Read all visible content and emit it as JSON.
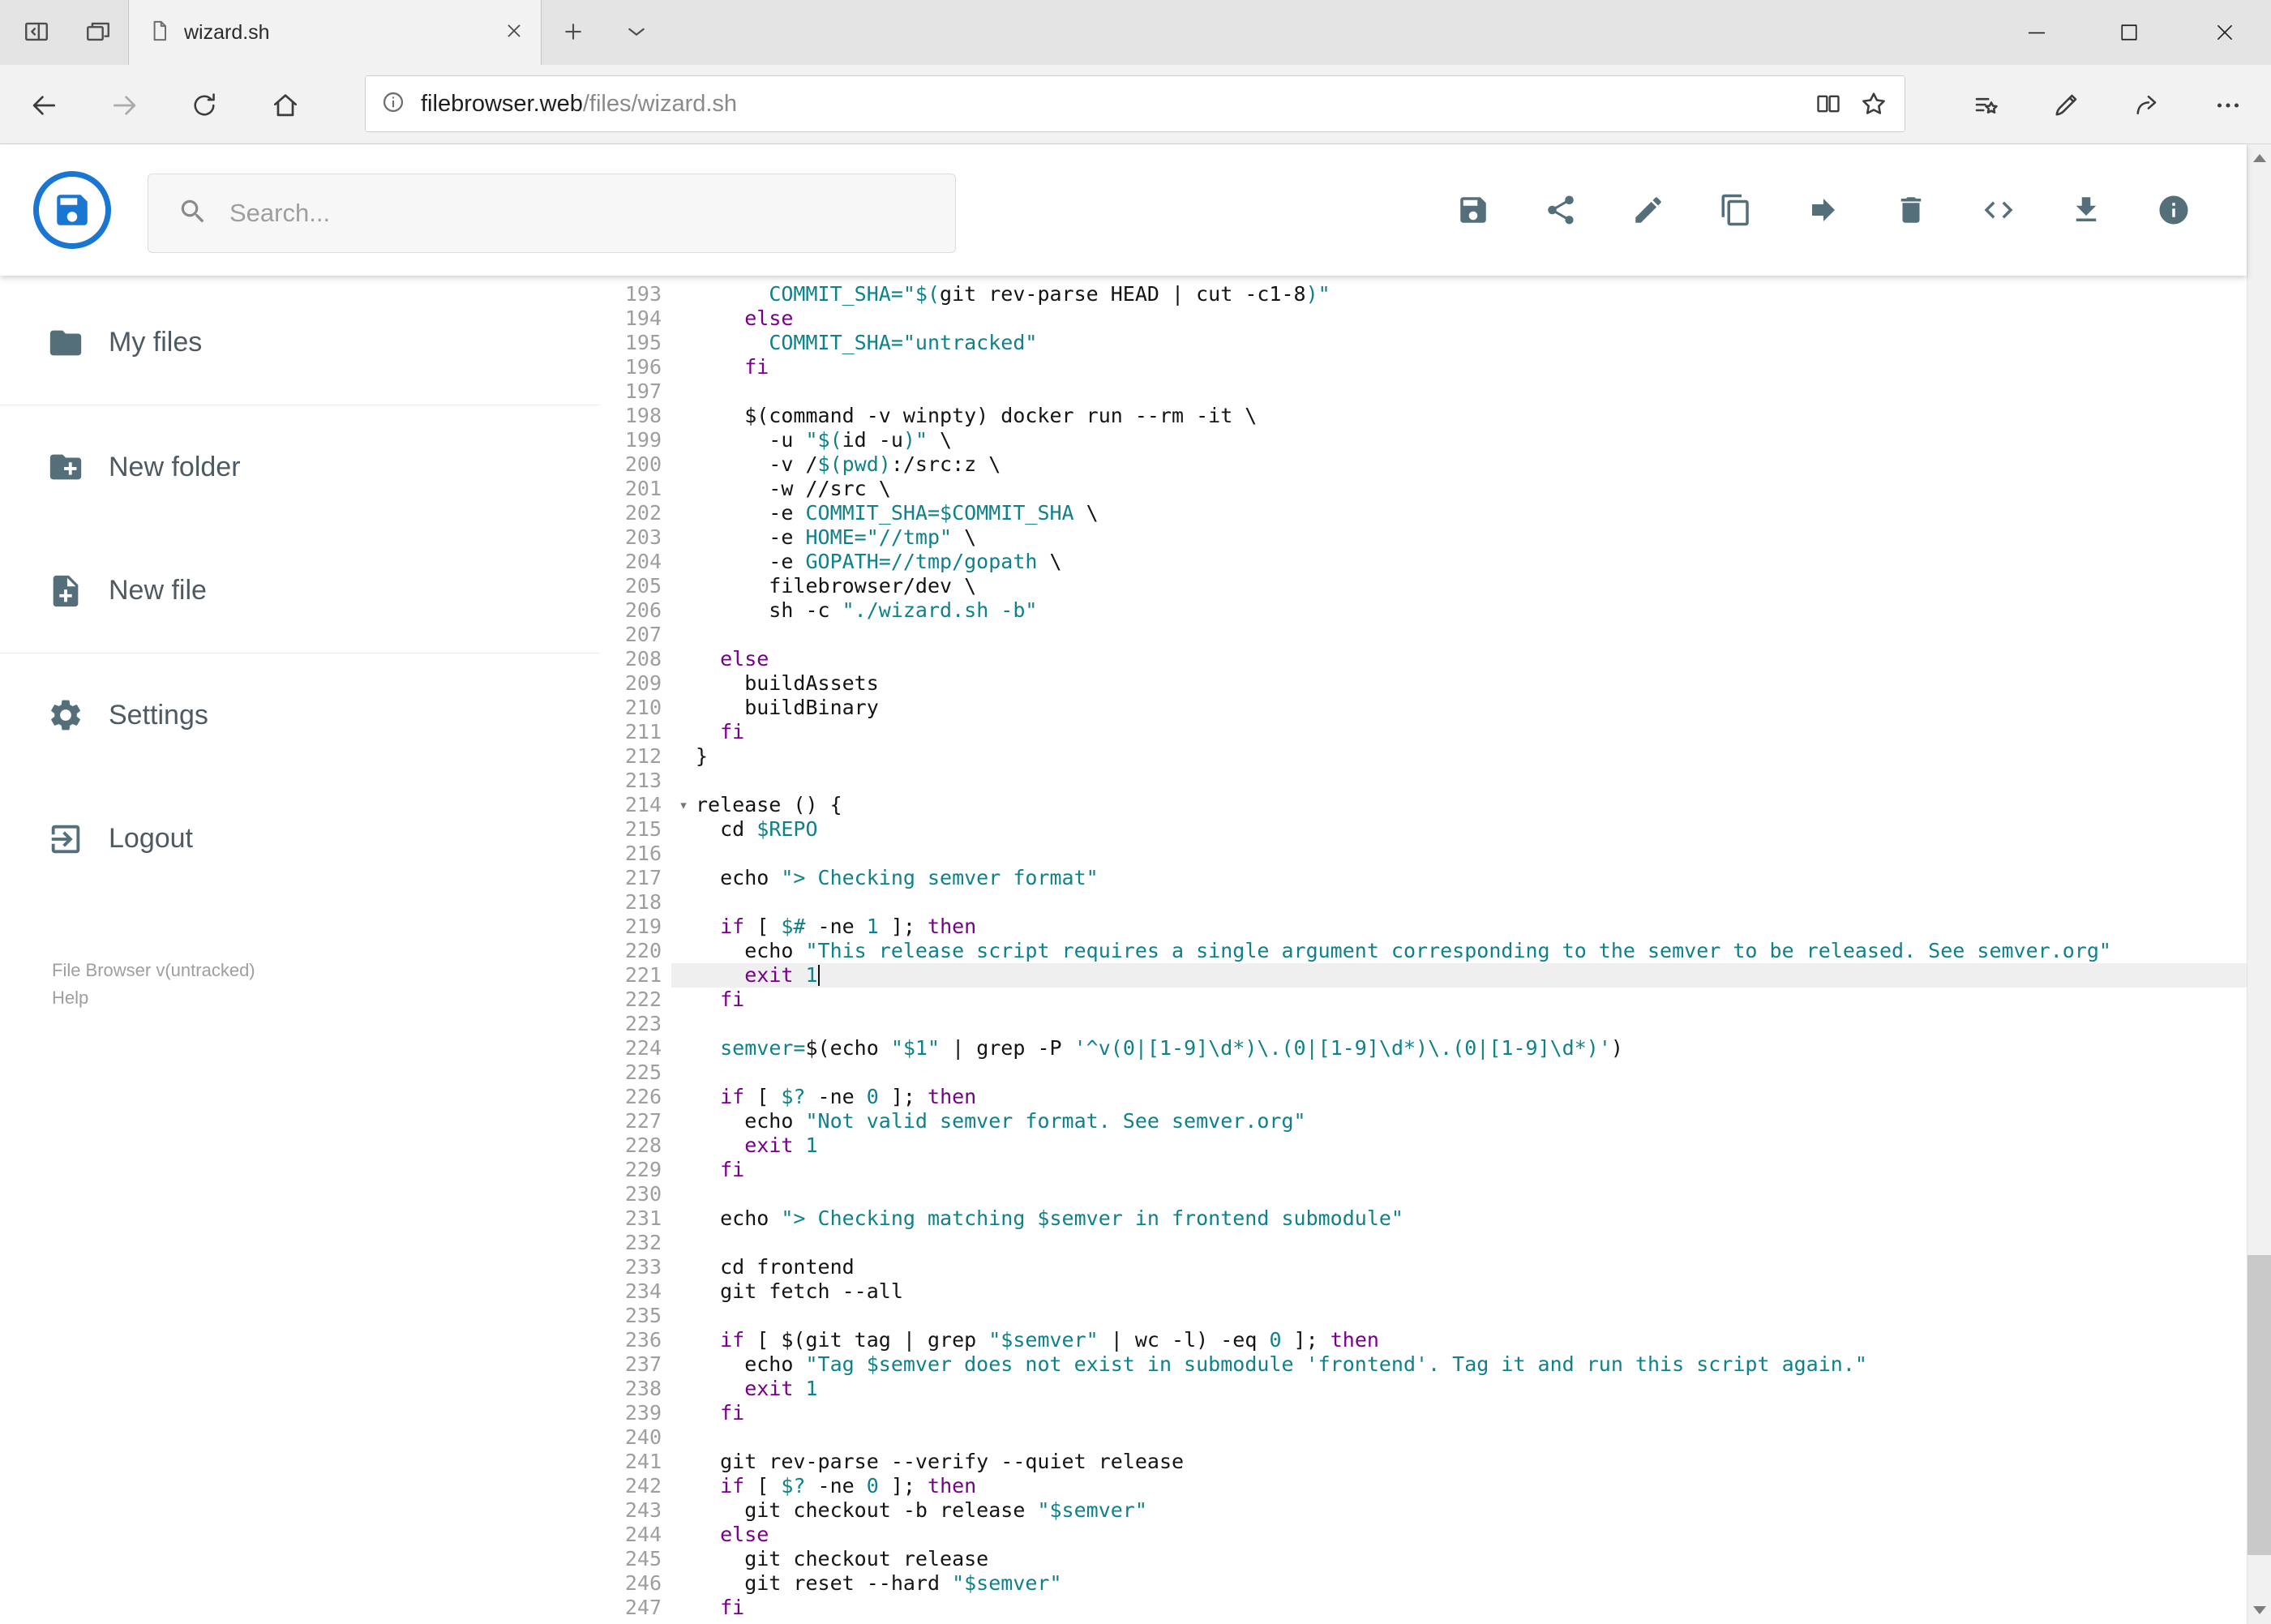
{
  "browser": {
    "tab": {
      "title": "wizard.sh"
    },
    "url": {
      "host": "filebrowser.web",
      "path": "/files/wizard.sh"
    },
    "window_controls": [
      "minimize",
      "maximize",
      "close"
    ],
    "nav_icons": [
      "back",
      "forward",
      "refresh",
      "home"
    ],
    "address_icons": [
      "site-info",
      "reading-view",
      "favorite-star"
    ],
    "right_icons": [
      "favorites-hub",
      "web-note",
      "share",
      "more-options"
    ]
  },
  "header": {
    "search_placeholder": "Search...",
    "toolbar_icons": [
      "save",
      "share",
      "edit",
      "copy",
      "move",
      "delete",
      "code",
      "download",
      "info"
    ]
  },
  "sidebar": {
    "items": [
      {
        "label": "My files",
        "icon": "folder-icon"
      },
      {
        "label": "New folder",
        "icon": "new-folder-icon"
      },
      {
        "label": "New file",
        "icon": "new-file-icon"
      },
      {
        "label": "Settings",
        "icon": "settings-icon"
      },
      {
        "label": "Logout",
        "icon": "logout-icon"
      }
    ],
    "footer": {
      "version": "File Browser v(untracked)",
      "help": "Help"
    }
  },
  "theme": {
    "code-plain": "#141414",
    "code-keyword": "#770088",
    "code-literal": "#0f8189",
    "code-gutter": "#9e9e9e",
    "active-line-bg": "#efefef",
    "icon-color": "#546e7a",
    "logo-blue": "#1976d2"
  },
  "editor": {
    "active_line": 221,
    "fold_glyph": "▾",
    "lines": [
      {
        "n": 193,
        "t": [
          [
            "p",
            "      "
          ],
          [
            "t",
            "COMMIT_SHA=\"$("
          ],
          [
            "p",
            "git rev-parse HEAD | cut -c1-8"
          ],
          [
            "t",
            ")\""
          ]
        ]
      },
      {
        "n": 194,
        "t": [
          [
            "p",
            "    "
          ],
          [
            "k",
            "else"
          ]
        ]
      },
      {
        "n": 195,
        "t": [
          [
            "p",
            "      "
          ],
          [
            "t",
            "COMMIT_SHA=\"untracked\""
          ]
        ]
      },
      {
        "n": 196,
        "t": [
          [
            "p",
            "    "
          ],
          [
            "k",
            "fi"
          ]
        ]
      },
      {
        "n": 197,
        "t": []
      },
      {
        "n": 198,
        "t": [
          [
            "p",
            "    $(command -v winpty) docker run --rm -it \\"
          ]
        ]
      },
      {
        "n": 199,
        "t": [
          [
            "p",
            "      -u "
          ],
          [
            "t",
            "\"$("
          ],
          [
            "p",
            "id -u"
          ],
          [
            "t",
            ")\""
          ],
          [
            "p",
            " \\"
          ]
        ]
      },
      {
        "n": 200,
        "t": [
          [
            "p",
            "      -v /"
          ],
          [
            "t",
            "$(pwd)"
          ],
          [
            "p",
            ":/src:z \\"
          ]
        ]
      },
      {
        "n": 201,
        "t": [
          [
            "p",
            "      -w //src \\"
          ]
        ]
      },
      {
        "n": 202,
        "t": [
          [
            "p",
            "      -e "
          ],
          [
            "t",
            "COMMIT_SHA=$COMMIT_SHA"
          ],
          [
            "p",
            " \\"
          ]
        ]
      },
      {
        "n": 203,
        "t": [
          [
            "p",
            "      -e "
          ],
          [
            "t",
            "HOME=\"//tmp\""
          ],
          [
            "p",
            " \\"
          ]
        ]
      },
      {
        "n": 204,
        "t": [
          [
            "p",
            "      -e "
          ],
          [
            "t",
            "GOPATH=//tmp/gopath"
          ],
          [
            "p",
            " \\"
          ]
        ]
      },
      {
        "n": 205,
        "t": [
          [
            "p",
            "      filebrowser/dev \\"
          ]
        ]
      },
      {
        "n": 206,
        "t": [
          [
            "p",
            "      sh -c "
          ],
          [
            "t",
            "\"./wizard.sh -b\""
          ]
        ]
      },
      {
        "n": 207,
        "t": []
      },
      {
        "n": 208,
        "t": [
          [
            "p",
            "  "
          ],
          [
            "k",
            "else"
          ]
        ]
      },
      {
        "n": 209,
        "t": [
          [
            "p",
            "    buildAssets"
          ]
        ]
      },
      {
        "n": 210,
        "t": [
          [
            "p",
            "    buildBinary"
          ]
        ]
      },
      {
        "n": 211,
        "t": [
          [
            "p",
            "  "
          ],
          [
            "k",
            "fi"
          ]
        ]
      },
      {
        "n": 212,
        "t": [
          [
            "p",
            "}"
          ]
        ]
      },
      {
        "n": 213,
        "t": []
      },
      {
        "n": 214,
        "fold": true,
        "t": [
          [
            "p",
            "release () {"
          ]
        ]
      },
      {
        "n": 215,
        "t": [
          [
            "p",
            "  cd "
          ],
          [
            "t",
            "$REPO"
          ]
        ]
      },
      {
        "n": 216,
        "t": []
      },
      {
        "n": 217,
        "t": [
          [
            "p",
            "  echo "
          ],
          [
            "t",
            "\"> Checking semver format\""
          ]
        ]
      },
      {
        "n": 218,
        "t": []
      },
      {
        "n": 219,
        "t": [
          [
            "p",
            "  "
          ],
          [
            "k",
            "if"
          ],
          [
            "p",
            " [ "
          ],
          [
            "t",
            "$#"
          ],
          [
            "p",
            " -ne "
          ],
          [
            "t",
            "1"
          ],
          [
            "p",
            " ]; "
          ],
          [
            "k",
            "then"
          ]
        ]
      },
      {
        "n": 220,
        "t": [
          [
            "p",
            "    echo "
          ],
          [
            "t",
            "\"This release script requires a single argument corresponding to the semver to be released. See semver.org\""
          ]
        ]
      },
      {
        "n": 221,
        "cursor": true,
        "t": [
          [
            "p",
            "    "
          ],
          [
            "k",
            "exit"
          ],
          [
            "p",
            " "
          ],
          [
            "t",
            "1"
          ]
        ]
      },
      {
        "n": 222,
        "t": [
          [
            "p",
            "  "
          ],
          [
            "k",
            "fi"
          ]
        ]
      },
      {
        "n": 223,
        "t": []
      },
      {
        "n": 224,
        "t": [
          [
            "p",
            "  "
          ],
          [
            "t",
            "semver="
          ],
          [
            "p",
            "$(echo "
          ],
          [
            "t",
            "\"$1\""
          ],
          [
            "p",
            " | grep -P "
          ],
          [
            "t",
            "'^v(0|[1-9]\\d*)\\.(0|[1-9]\\d*)\\.(0|[1-9]\\d*)'"
          ],
          [
            "p",
            ")"
          ]
        ]
      },
      {
        "n": 225,
        "t": []
      },
      {
        "n": 226,
        "t": [
          [
            "p",
            "  "
          ],
          [
            "k",
            "if"
          ],
          [
            "p",
            " [ "
          ],
          [
            "t",
            "$?"
          ],
          [
            "p",
            " -ne "
          ],
          [
            "t",
            "0"
          ],
          [
            "p",
            " ]; "
          ],
          [
            "k",
            "then"
          ]
        ]
      },
      {
        "n": 227,
        "t": [
          [
            "p",
            "    echo "
          ],
          [
            "t",
            "\"Not valid semver format. See semver.org\""
          ]
        ]
      },
      {
        "n": 228,
        "t": [
          [
            "p",
            "    "
          ],
          [
            "k",
            "exit"
          ],
          [
            "p",
            " "
          ],
          [
            "t",
            "1"
          ]
        ]
      },
      {
        "n": 229,
        "t": [
          [
            "p",
            "  "
          ],
          [
            "k",
            "fi"
          ]
        ]
      },
      {
        "n": 230,
        "t": []
      },
      {
        "n": 231,
        "t": [
          [
            "p",
            "  echo "
          ],
          [
            "t",
            "\"> Checking matching $semver in frontend submodule\""
          ]
        ]
      },
      {
        "n": 232,
        "t": []
      },
      {
        "n": 233,
        "t": [
          [
            "p",
            "  cd frontend"
          ]
        ]
      },
      {
        "n": 234,
        "t": [
          [
            "p",
            "  git fetch --all"
          ]
        ]
      },
      {
        "n": 235,
        "t": []
      },
      {
        "n": 236,
        "t": [
          [
            "p",
            "  "
          ],
          [
            "k",
            "if"
          ],
          [
            "p",
            " [ $(git tag | grep "
          ],
          [
            "t",
            "\"$semver\""
          ],
          [
            "p",
            " | wc -l) -eq "
          ],
          [
            "t",
            "0"
          ],
          [
            "p",
            " ]; "
          ],
          [
            "k",
            "then"
          ]
        ]
      },
      {
        "n": 237,
        "t": [
          [
            "p",
            "    echo "
          ],
          [
            "t",
            "\"Tag $semver does not exist in submodule 'frontend'. Tag it and run this script again.\""
          ]
        ]
      },
      {
        "n": 238,
        "t": [
          [
            "p",
            "    "
          ],
          [
            "k",
            "exit"
          ],
          [
            "p",
            " "
          ],
          [
            "t",
            "1"
          ]
        ]
      },
      {
        "n": 239,
        "t": [
          [
            "p",
            "  "
          ],
          [
            "k",
            "fi"
          ]
        ]
      },
      {
        "n": 240,
        "t": []
      },
      {
        "n": 241,
        "t": [
          [
            "p",
            "  git rev-parse --verify --quiet release"
          ]
        ]
      },
      {
        "n": 242,
        "t": [
          [
            "p",
            "  "
          ],
          [
            "k",
            "if"
          ],
          [
            "p",
            " [ "
          ],
          [
            "t",
            "$?"
          ],
          [
            "p",
            " -ne "
          ],
          [
            "t",
            "0"
          ],
          [
            "p",
            " ]; "
          ],
          [
            "k",
            "then"
          ]
        ]
      },
      {
        "n": 243,
        "t": [
          [
            "p",
            "    git checkout -b release "
          ],
          [
            "t",
            "\"$semver\""
          ]
        ]
      },
      {
        "n": 244,
        "t": [
          [
            "p",
            "  "
          ],
          [
            "k",
            "else"
          ]
        ]
      },
      {
        "n": 245,
        "t": [
          [
            "p",
            "    git checkout release"
          ]
        ]
      },
      {
        "n": 246,
        "t": [
          [
            "p",
            "    git reset --hard "
          ],
          [
            "t",
            "\"$semver\""
          ]
        ]
      },
      {
        "n": 247,
        "t": [
          [
            "p",
            "  "
          ],
          [
            "k",
            "fi"
          ]
        ]
      }
    ]
  }
}
